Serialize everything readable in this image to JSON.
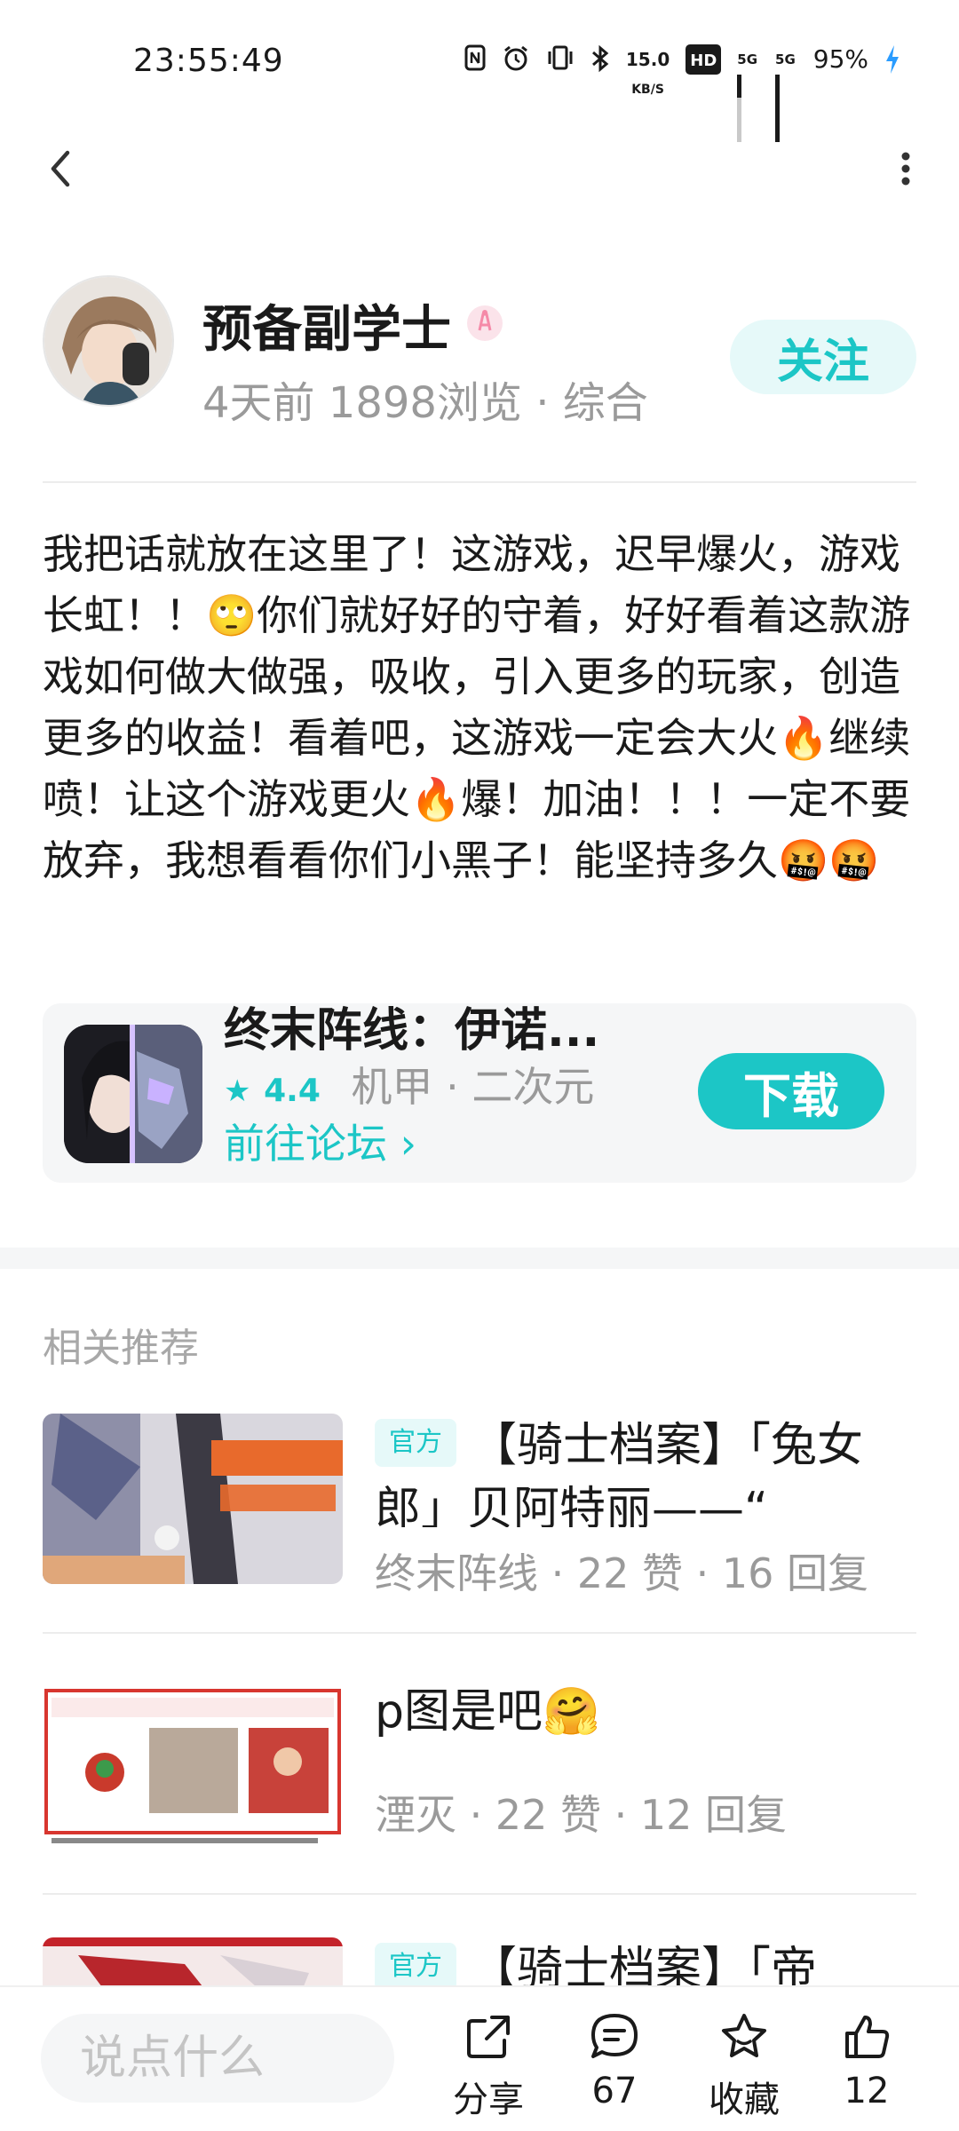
{
  "status_bar": {
    "time": "23:55:49",
    "net_speed_value": "15.0",
    "net_speed_unit": "KB/S",
    "hd_label": "HD",
    "sim1_label": "5G",
    "sim2_label": "5G",
    "battery": "95%"
  },
  "author": {
    "name": "预备副学士",
    "meta": "4天前 1898浏览 · 综合",
    "follow_label": "关注"
  },
  "post": {
    "body": "我把话就放在这里了！这游戏，迟早爆火，游戏长虹！！🙄你们就好好的守着，好好看着这款游戏如何做大做强，吸收，引入更多的玩家，创造更多的收益！看着吧，这游戏一定会大火🔥继续喷！让这个游戏更火🔥爆！加油！！！一定不要放弃，我想看看你们小黑子！能坚持多久🤬🤬"
  },
  "game_card": {
    "title": "终末阵线：伊诺...",
    "rating": "4.4",
    "tags": "机甲 · 二次元",
    "forum_link": "前往论坛 ›",
    "download_label": "下载"
  },
  "related": {
    "section_title": "相关推荐",
    "items": [
      {
        "tag": "官方",
        "title": "【骑士档案】「兔女郎」贝阿特丽——“",
        "meta": "终末阵线 · 22 赞 · 16 回复"
      },
      {
        "tag": "",
        "title": "p图是吧🤗",
        "meta": "湮灭 · 22 赞 · 12 回复"
      },
      {
        "tag": "官方",
        "title": "【骑士档案】「帝",
        "meta": ""
      }
    ]
  },
  "bottom_bar": {
    "comment_placeholder": "说点什么",
    "share_label": "分享",
    "comment_count": "67",
    "favorite_label": "收藏",
    "like_count": "12"
  },
  "colors": {
    "accent": "#1cc6c6",
    "accent_light": "#e6f9f9",
    "muted_text": "#9a9a9a",
    "card_bg": "#f5f6f7"
  },
  "icons": [
    "back-icon",
    "more-icon",
    "share-icon",
    "comment-icon",
    "star-icon",
    "thumbs-up-icon",
    "rating-star-icon",
    "verified-badge-icon"
  ]
}
